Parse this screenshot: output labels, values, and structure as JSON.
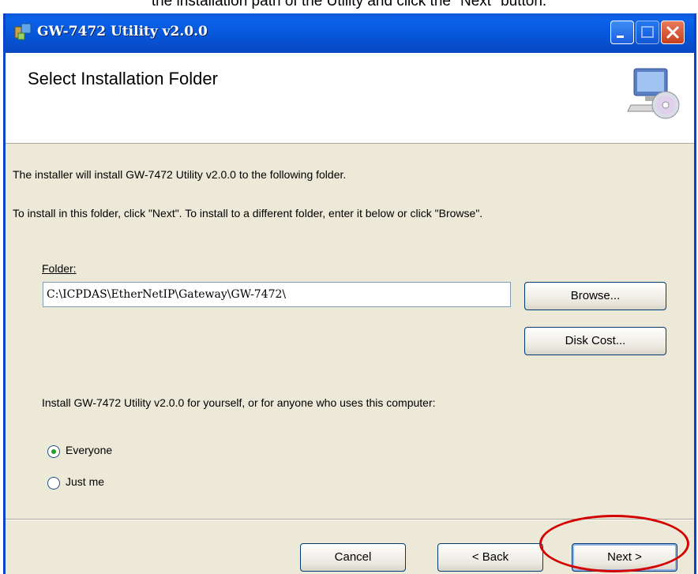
{
  "caption": "the installation path of the Utility and click the \"Next\" button.",
  "window": {
    "title": "GW-7472 Utility v2.0.0"
  },
  "header": {
    "title": "Select Installation Folder"
  },
  "body": {
    "intro_line": "The installer will install GW-7472 Utility v2.0.0 to the following folder.",
    "instruction_line": "To install in this folder, click \"Next\". To install to a different folder, enter it below or click \"Browse\".",
    "folder_label": "Folder:",
    "folder_value": "C:\\ICPDAS\\EtherNetIP\\Gateway\\GW-7472\\",
    "browse_label": "Browse...",
    "disk_cost_label": "Disk Cost...",
    "install_for_text": "Install GW-7472 Utility v2.0.0 for yourself, or for anyone who uses this computer:",
    "radio_options": [
      {
        "label": "Everyone",
        "selected": true
      },
      {
        "label": "Just me",
        "selected": false
      }
    ]
  },
  "footer": {
    "cancel_label": "Cancel",
    "back_label": "< Back",
    "next_label": "Next >"
  },
  "colors": {
    "titlebar": "#0b62ea",
    "dialog_bg": "#ece9d8",
    "highlight": "#d40000",
    "radio_selected": "#21a121"
  }
}
